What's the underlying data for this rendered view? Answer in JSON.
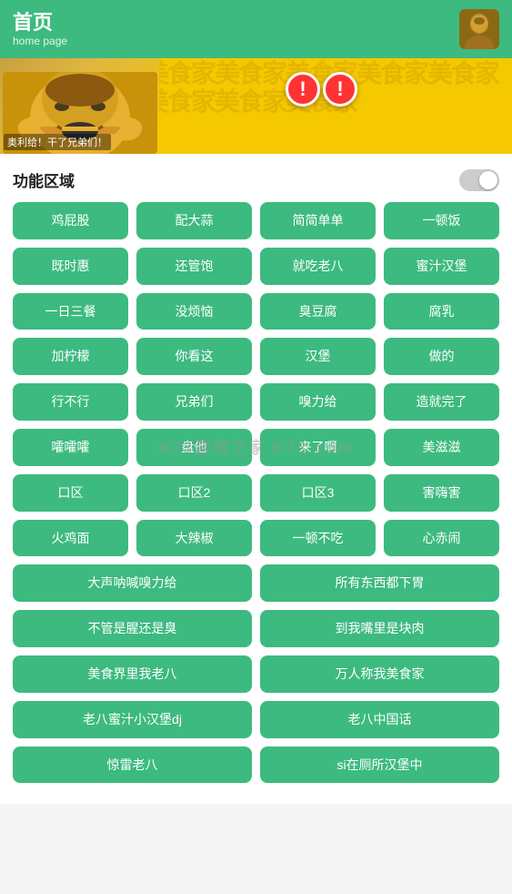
{
  "header": {
    "title": "首页",
    "subtitle": "home page",
    "avatar_label": "user avatar"
  },
  "banner": {
    "caption": "奥利给！干了兄弟们！",
    "exclamation": "!!",
    "pattern_text": "美食家美食家美食家美食家美食家美食家美食家美食家美食家美食家美食家美食家"
  },
  "section": {
    "title": "功能区域"
  },
  "watermark": "K73游戏之家\nK73.com",
  "buttons_row1": [
    "鸡屁股",
    "配大蒜",
    "简简单单",
    "一顿饭"
  ],
  "buttons_row2": [
    "既时惠",
    "还管饱",
    "就吃老八",
    "蜜汁汉堡"
  ],
  "buttons_row3": [
    "一日三餐",
    "没烦恼",
    "臭豆腐",
    "腐乳"
  ],
  "buttons_row4": [
    "加柠檬",
    "你看这",
    "汉堡",
    "做的"
  ],
  "buttons_row5": [
    "行不行",
    "兄弟们",
    "嗅力给",
    "造就完了"
  ],
  "buttons_row6": [
    "嚯嚯嚯",
    "盘他",
    "来了啊",
    "美滋滋"
  ],
  "buttons_row7": [
    "口区",
    "口区2",
    "口区3",
    "害嗨害"
  ],
  "buttons_row8": [
    "火鸡面",
    "大辣椒",
    "一顿不吃",
    "心赤闹"
  ],
  "buttons_row9": [
    "大声呐喊嗅力给",
    "所有东西都下胃"
  ],
  "buttons_row10": [
    "不管是腥还是臭",
    "到我嘴里是块肉"
  ],
  "buttons_row11": [
    "美食界里我老八",
    "万人称我美食家"
  ],
  "buttons_row12": [
    "老八蜜汁小汉堡dj",
    "老八中国话"
  ],
  "buttons_row13": [
    "惊雷老八",
    "si在厕所汉堡中"
  ]
}
